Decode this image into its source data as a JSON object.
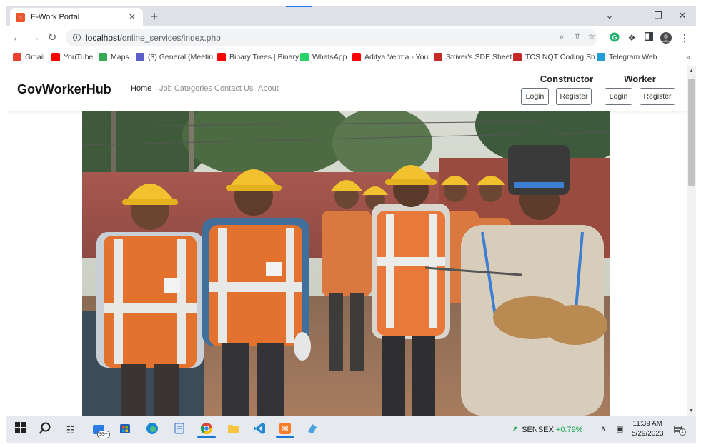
{
  "browser": {
    "tab_title": "E-Work Portal",
    "url_host": "localhost",
    "url_path": "/online_services/index.php",
    "bookmarks": [
      {
        "label": "Gmail",
        "color": "#ea4335"
      },
      {
        "label": "YouTube",
        "color": "#ff0000"
      },
      {
        "label": "Maps",
        "color": "#34a853"
      },
      {
        "label": "(3) General (Meetin...",
        "color": "#5b5fc7"
      },
      {
        "label": "Binary Trees | Binary...",
        "color": "#ff0000"
      },
      {
        "label": "WhatsApp",
        "color": "#25d366"
      },
      {
        "label": "Aditya Verma - You...",
        "color": "#ff0000"
      },
      {
        "label": "Striver's SDE Sheet...",
        "color": "#c62828"
      },
      {
        "label": "TCS NQT Coding Sh...",
        "color": "#c62828"
      },
      {
        "label": "Telegram Web",
        "color": "#229ed9"
      }
    ],
    "more": "»"
  },
  "site": {
    "brand": "GovWorkerHub",
    "nav": [
      "Home",
      "Job Categories",
      "Contact Us",
      "About"
    ],
    "constructor": {
      "title": "Constructor",
      "login": "Login",
      "register": "Register"
    },
    "worker": {
      "title": "Worker",
      "login": "Login",
      "register": "Register"
    }
  },
  "taskbar": {
    "edge_badge": "99+",
    "sensex_label": "SENSEX",
    "sensex_change": "+0.79%",
    "time": "11:39 AM",
    "date": "5/29/2023",
    "notif_count": "1"
  }
}
